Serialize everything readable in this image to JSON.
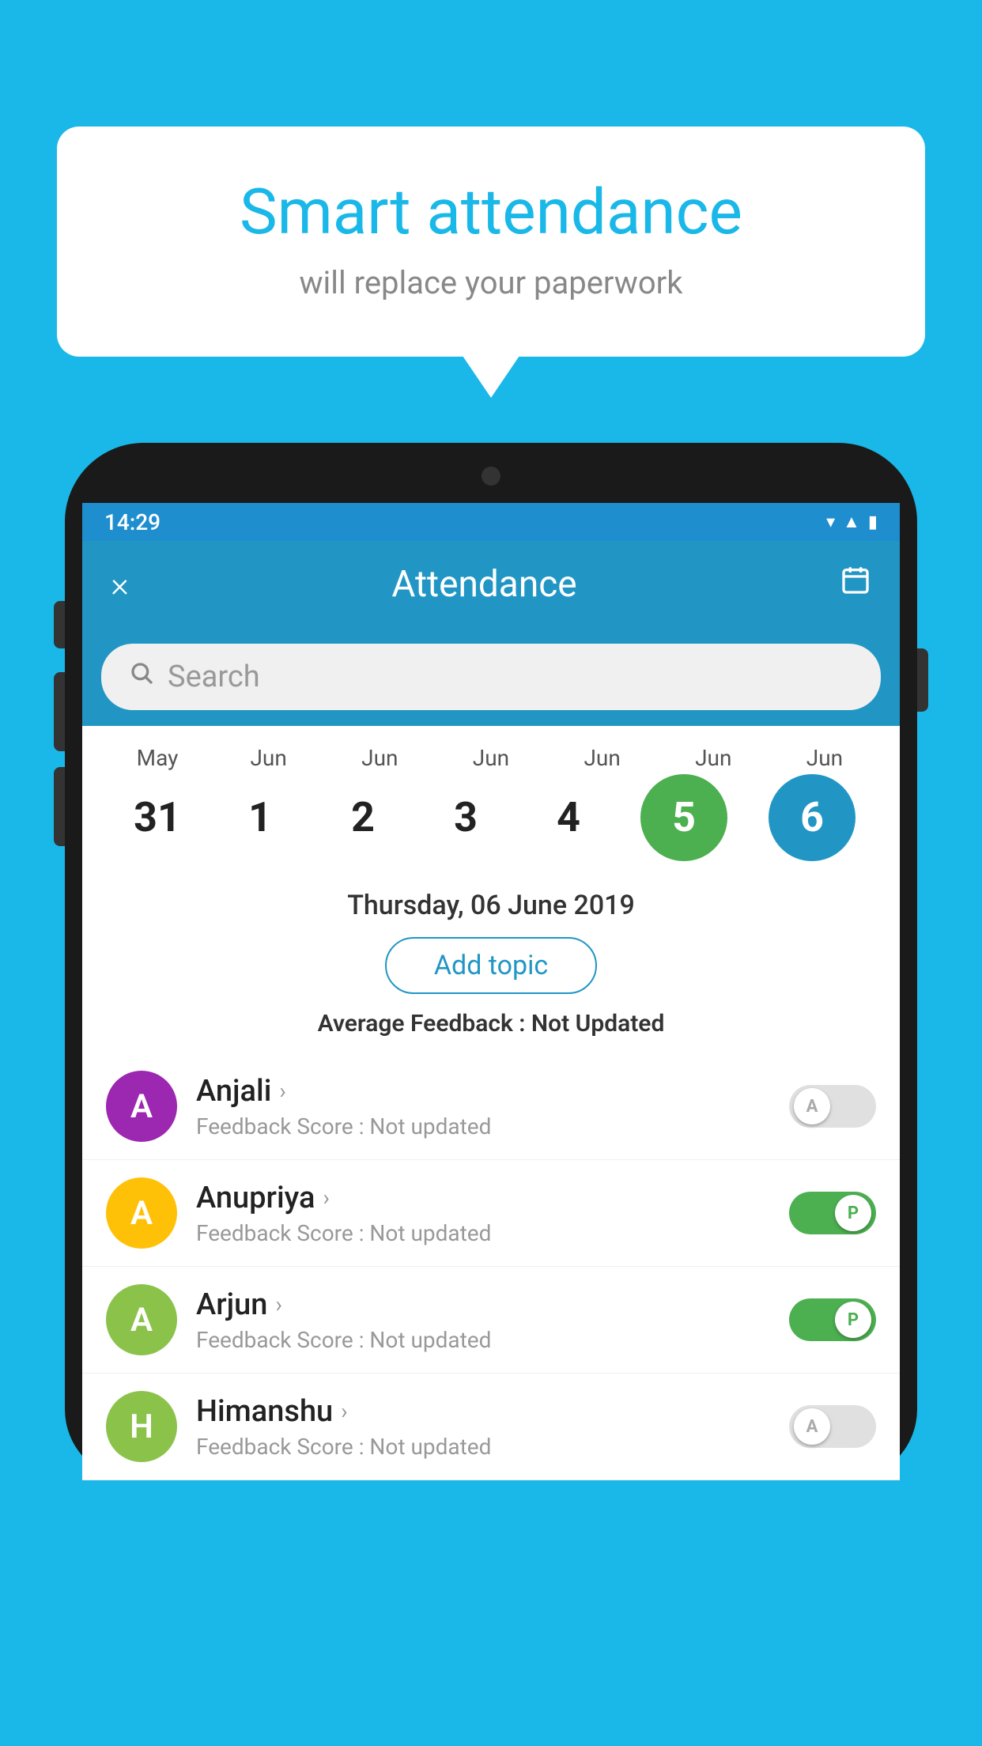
{
  "background_color": "#1ab8e8",
  "speech_bubble": {
    "title": "Smart attendance",
    "subtitle": "will replace your paperwork"
  },
  "status_bar": {
    "time": "14:29",
    "icons": [
      "wifi",
      "signal",
      "battery"
    ]
  },
  "app_header": {
    "title": "Attendance",
    "close_label": "×",
    "calendar_icon": "📅"
  },
  "search": {
    "placeholder": "Search"
  },
  "calendar": {
    "months": [
      "May",
      "Jun",
      "Jun",
      "Jun",
      "Jun",
      "Jun",
      "Jun"
    ],
    "days": [
      "31",
      "1",
      "2",
      "3",
      "4",
      "5",
      "6"
    ],
    "today_index": 5,
    "selected_index": 6
  },
  "date_display": "Thursday, 06 June 2019",
  "add_topic_label": "Add topic",
  "avg_feedback_label": "Average Feedback :",
  "avg_feedback_value": "Not Updated",
  "students": [
    {
      "name": "Anjali",
      "avatar_letter": "A",
      "avatar_color": "#9c27b0",
      "feedback_label": "Feedback Score :",
      "feedback_value": "Not updated",
      "toggle_state": "off",
      "toggle_letter": "A"
    },
    {
      "name": "Anupriya",
      "avatar_letter": "A",
      "avatar_color": "#ffc107",
      "feedback_label": "Feedback Score :",
      "feedback_value": "Not updated",
      "toggle_state": "on",
      "toggle_letter": "P"
    },
    {
      "name": "Arjun",
      "avatar_letter": "A",
      "avatar_color": "#8bc34a",
      "feedback_label": "Feedback Score :",
      "feedback_value": "Not updated",
      "toggle_state": "on",
      "toggle_letter": "P"
    },
    {
      "name": "Himanshu",
      "avatar_letter": "H",
      "avatar_color": "#8bc34a",
      "feedback_label": "Feedback Score :",
      "feedback_value": "Not updated",
      "toggle_state": "off",
      "toggle_letter": "A"
    }
  ]
}
